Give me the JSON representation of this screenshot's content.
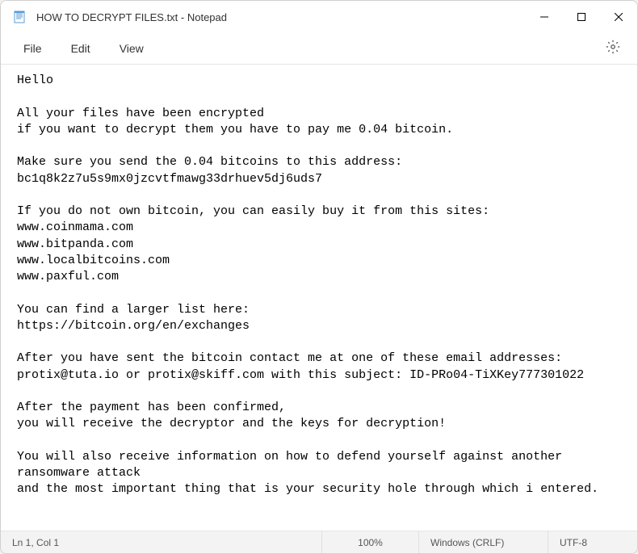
{
  "titlebar": {
    "title": "HOW TO DECRYPT FILES.txt - Notepad"
  },
  "menu": {
    "file": "File",
    "edit": "Edit",
    "view": "View"
  },
  "content": "Hello\n\nAll your files have been encrypted\nif you want to decrypt them you have to pay me 0.04 bitcoin.\n\nMake sure you send the 0.04 bitcoins to this address:\nbc1q8k2z7u5s9mx0jzcvtfmawg33drhuev5dj6uds7\n\nIf you do not own bitcoin, you can easily buy it from this sites:\nwww.coinmama.com\nwww.bitpanda.com\nwww.localbitcoins.com\nwww.paxful.com\n\nYou can find a larger list here:\nhttps://bitcoin.org/en/exchanges\n\nAfter you have sent the bitcoin contact me at one of these email addresses:\nprotix@tuta.io or protix@skiff.com with this subject: ID-PRo04-TiXKey777301022\n\nAfter the payment has been confirmed,\nyou will receive the decryptor and the keys for decryption!\n\nYou will also receive information on how to defend yourself against another ransomware attack\nand the most important thing that is your security hole through which i entered.",
  "statusbar": {
    "position": "Ln 1, Col 1",
    "zoom": "100%",
    "line_ending": "Windows (CRLF)",
    "encoding": "UTF-8"
  }
}
